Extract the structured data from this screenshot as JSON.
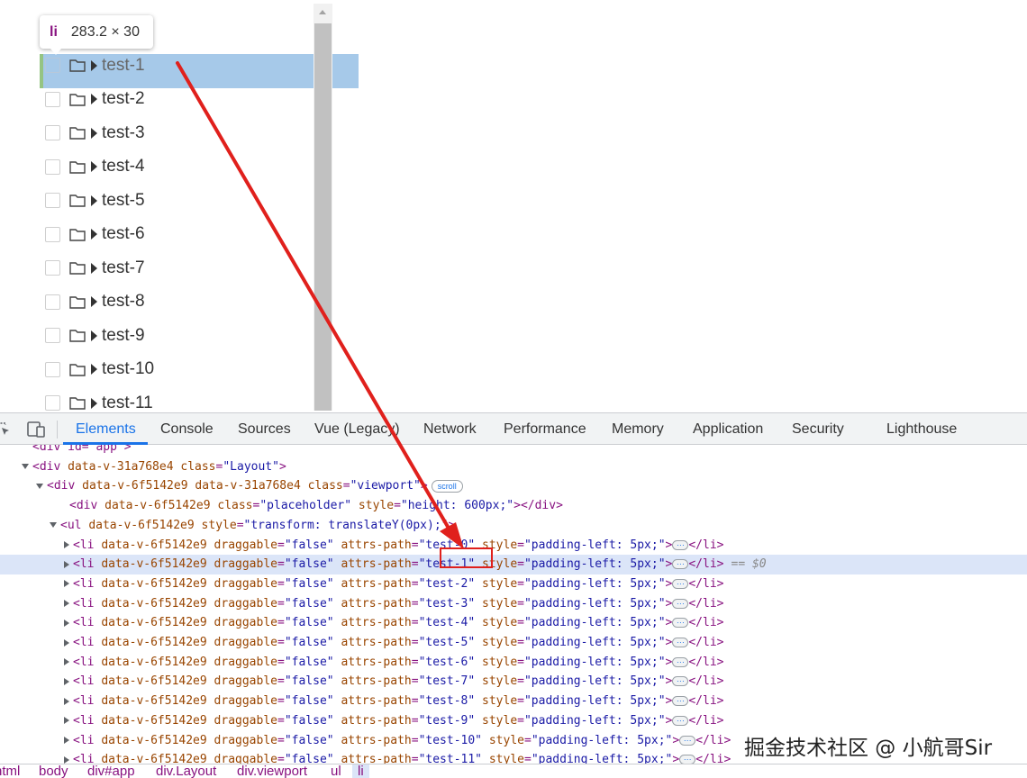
{
  "tooltip": {
    "tag": "li",
    "size": "283.2 × 30"
  },
  "tree": {
    "items": [
      {
        "label": "test-1",
        "highlighted": true
      },
      {
        "label": "test-2"
      },
      {
        "label": "test-3"
      },
      {
        "label": "test-4"
      },
      {
        "label": "test-5"
      },
      {
        "label": "test-6"
      },
      {
        "label": "test-7"
      },
      {
        "label": "test-8"
      },
      {
        "label": "test-9"
      },
      {
        "label": "test-10"
      },
      {
        "label": "test-11"
      }
    ]
  },
  "devtools": {
    "tabs": [
      "Elements",
      "Console",
      "Sources",
      "Vue (Legacy)",
      "Network",
      "Performance",
      "Memory",
      "Application",
      "Security",
      "Lighthouse"
    ],
    "active_tab": "Elements",
    "code": {
      "partial_line": "<div id=\"app\">",
      "layout_div": {
        "tag": "div",
        "attrs": [
          [
            "data-v-31a768e4",
            null
          ],
          [
            "class",
            "Layout"
          ]
        ]
      },
      "viewport_div": {
        "tag": "div",
        "attrs": [
          [
            "data-v-6f5142e9",
            null
          ],
          [
            "data-v-31a768e4",
            null
          ],
          [
            "class",
            "viewport"
          ]
        ],
        "badge": "scroll"
      },
      "placeholder_div": {
        "tag": "div",
        "attrs": [
          [
            "data-v-6f5142e9",
            null
          ],
          [
            "class",
            "placeholder"
          ],
          [
            "style",
            "height: 600px;"
          ]
        ],
        "close": "</div>"
      },
      "ul": {
        "tag": "ul",
        "attrs": [
          [
            "data-v-6f5142e9",
            null
          ],
          [
            "style",
            "transform: translateY(0px);"
          ]
        ]
      },
      "li_paths": [
        "test-0",
        "test-1",
        "test-2",
        "test-3",
        "test-4",
        "test-5",
        "test-6",
        "test-7",
        "test-8",
        "test-9",
        "test-10",
        "test-11"
      ],
      "li_attr_scope": "data-v-6f5142e9",
      "li_draggable": "false",
      "li_style": "padding-left: 5px;",
      "selected_index": 1,
      "selected_marker": "== $0"
    },
    "breadcrumb": [
      "html",
      "body",
      "div#app",
      "div.Layout",
      "div.viewport",
      "ul",
      "li"
    ]
  },
  "watermark": "掘金技术社区 @ 小航哥Sir",
  "colors": {
    "accent": "#1a73e8",
    "annotation": "#e0201c",
    "tag": "#881280",
    "attr": "#994500",
    "value": "#1a1aa6"
  }
}
